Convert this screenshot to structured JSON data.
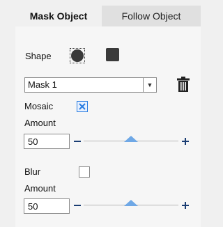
{
  "tabs": [
    {
      "label": "Mask Object",
      "active": true
    },
    {
      "label": "Follow Object",
      "active": false
    }
  ],
  "shape": {
    "label": "Shape",
    "options": [
      {
        "name": "circle-shape",
        "selected": true
      },
      {
        "name": "square-shape",
        "selected": false
      }
    ]
  },
  "mask_select": {
    "value": "Mask 1",
    "arrow_icon": "chevron-down-icon"
  },
  "delete_icon": "trash-icon",
  "mosaic": {
    "label": "Mosaic",
    "checked": true,
    "amount_label": "Amount",
    "amount_value": "50",
    "slider_fraction": 0.5
  },
  "blur": {
    "label": "Blur",
    "checked": false,
    "amount_label": "Amount",
    "amount_value": "50",
    "slider_fraction": 0.5
  },
  "colors": {
    "accent": "#2a7de1",
    "slider_thumb": "#6fa8e6",
    "stepper_sign": "#1a3d73",
    "tab_inactive_bg": "#e0e0e0"
  }
}
